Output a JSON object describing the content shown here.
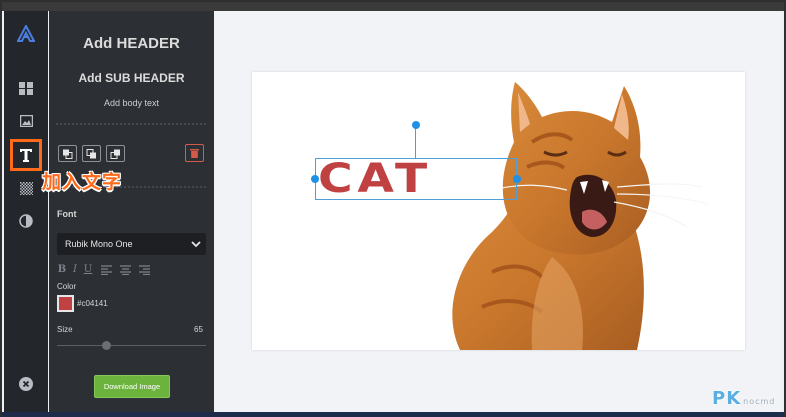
{
  "rail": {
    "annotation_label": "加入文字"
  },
  "panel": {
    "header_text": "Add HEADER",
    "subheader_text": "Add SUB HEADER",
    "body_text": "Add body text",
    "font_label": "Font",
    "font_value": "Rubik Mono One",
    "format_buttons": [
      "B",
      "I",
      "U"
    ],
    "color_label": "Color",
    "color_hex": "#c04141",
    "size_label": "Size",
    "size_value": "65",
    "size_slider_fraction": 0.33,
    "download_label": "Download Image"
  },
  "canvas": {
    "text_layer": "CAT",
    "text_color": "#c04141"
  },
  "watermark": {
    "text": "PK",
    "sub": "nocmd"
  },
  "colors": {
    "accent_orange": "#ff6a1a",
    "selection_blue": "#1e90e6",
    "download_green": "#6cb33e"
  }
}
